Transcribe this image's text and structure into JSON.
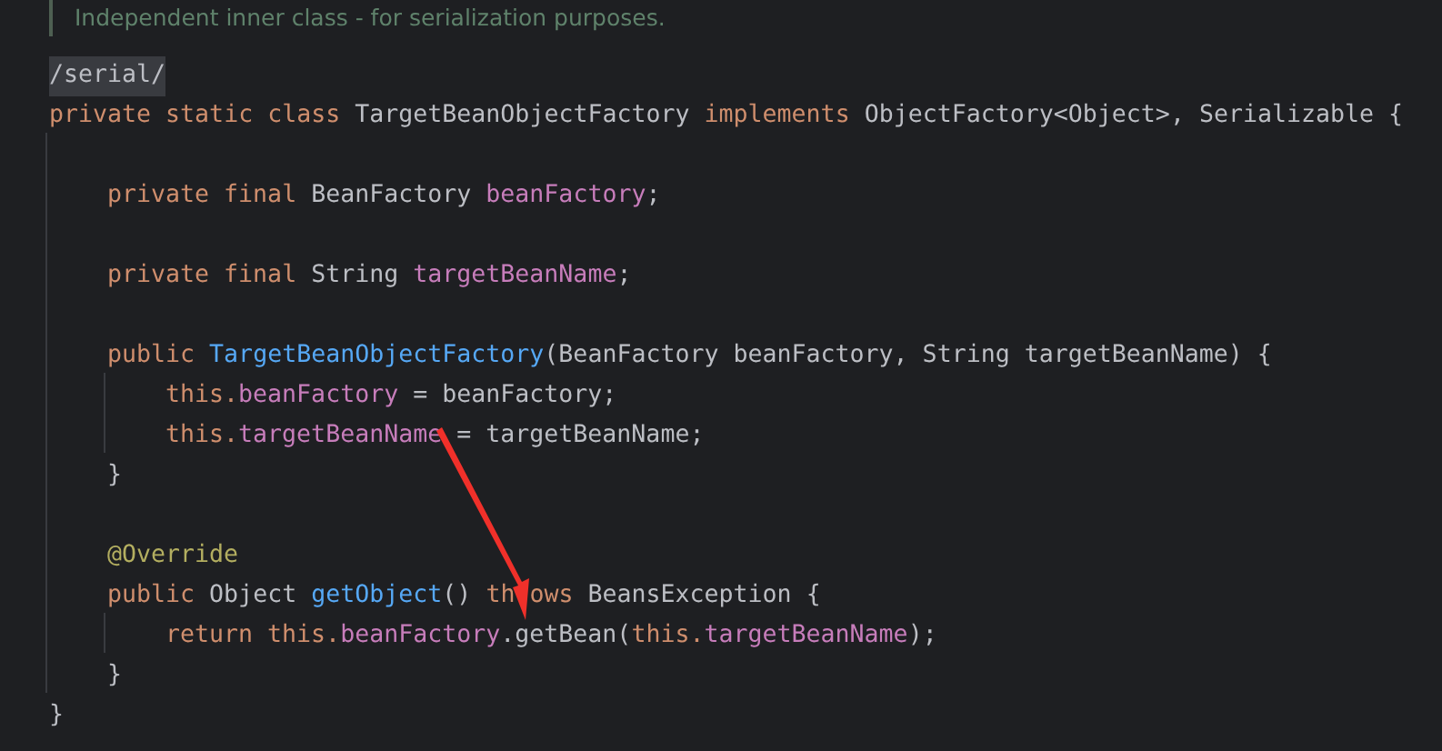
{
  "doc_comment": "Independent inner class - for serialization purposes.",
  "code_lines": [
    {
      "kind": "highlight",
      "tokens": [
        {
          "kind": "plain",
          "text": "/serial/"
        }
      ]
    },
    {
      "kind": "code",
      "tokens": [
        {
          "kind": "keyword",
          "text": "private static class "
        },
        {
          "kind": "plain",
          "text": "TargetBeanObjectFactory "
        },
        {
          "kind": "keyword",
          "text": "implements "
        },
        {
          "kind": "plain",
          "text": "ObjectFactory<Object>, Serializable {"
        }
      ],
      "children": [
        {
          "kind": "blank"
        },
        {
          "kind": "code",
          "tokens": [
            {
              "kind": "keyword",
              "text": "private final "
            },
            {
              "kind": "plain",
              "text": "BeanFactory "
            },
            {
              "kind": "field",
              "text": "beanFactory"
            },
            {
              "kind": "plain",
              "text": ";"
            }
          ]
        },
        {
          "kind": "blank"
        },
        {
          "kind": "code",
          "tokens": [
            {
              "kind": "keyword",
              "text": "private final "
            },
            {
              "kind": "plain",
              "text": "String "
            },
            {
              "kind": "field",
              "text": "targetBeanName"
            },
            {
              "kind": "plain",
              "text": ";"
            }
          ]
        },
        {
          "kind": "blank"
        },
        {
          "kind": "code",
          "tokens": [
            {
              "kind": "keyword",
              "text": "public "
            },
            {
              "kind": "method",
              "text": "TargetBeanObjectFactory"
            },
            {
              "kind": "plain",
              "text": "(BeanFactory beanFactory, String targetBeanName) {"
            }
          ],
          "children": [
            {
              "kind": "code",
              "tokens": [
                {
                  "kind": "keyword",
                  "text": "this."
                },
                {
                  "kind": "field",
                  "text": "beanFactory"
                },
                {
                  "kind": "plain",
                  "text": " = beanFactory;"
                }
              ]
            },
            {
              "kind": "code",
              "tokens": [
                {
                  "kind": "keyword",
                  "text": "this."
                },
                {
                  "kind": "field",
                  "text": "targetBeanName"
                },
                {
                  "kind": "plain",
                  "text": " = targetBeanName;"
                }
              ]
            }
          ]
        },
        {
          "kind": "code",
          "tokens": [
            {
              "kind": "plain",
              "text": "}"
            }
          ]
        },
        {
          "kind": "blank"
        },
        {
          "kind": "code",
          "tokens": [
            {
              "kind": "annotation",
              "text": "@Override"
            }
          ]
        },
        {
          "kind": "code",
          "tokens": [
            {
              "kind": "keyword",
              "text": "public "
            },
            {
              "kind": "plain",
              "text": "Object "
            },
            {
              "kind": "method",
              "text": "getObject"
            },
            {
              "kind": "plain",
              "text": "() "
            },
            {
              "kind": "keyword",
              "text": "th"
            },
            {
              "kind": "covered"
            },
            {
              "kind": "keyword",
              "text": "ows "
            },
            {
              "kind": "plain",
              "text": "BeansException {"
            }
          ],
          "children": [
            {
              "kind": "code",
              "tokens": [
                {
                  "kind": "keyword",
                  "text": "return this."
                },
                {
                  "kind": "field",
                  "text": "beanFactory"
                },
                {
                  "kind": "plain",
                  "text": ".getBean("
                },
                {
                  "kind": "keyword",
                  "text": "this."
                },
                {
                  "kind": "field",
                  "text": "targetBeanName"
                },
                {
                  "kind": "plain",
                  "text": ");"
                }
              ]
            }
          ]
        },
        {
          "kind": "code",
          "tokens": [
            {
              "kind": "plain",
              "text": "}"
            }
          ]
        }
      ]
    },
    {
      "kind": "code",
      "tokens": [
        {
          "kind": "plain",
          "text": "}"
        }
      ]
    }
  ],
  "annotations": [
    {
      "kind": "arrow"
    }
  ]
}
